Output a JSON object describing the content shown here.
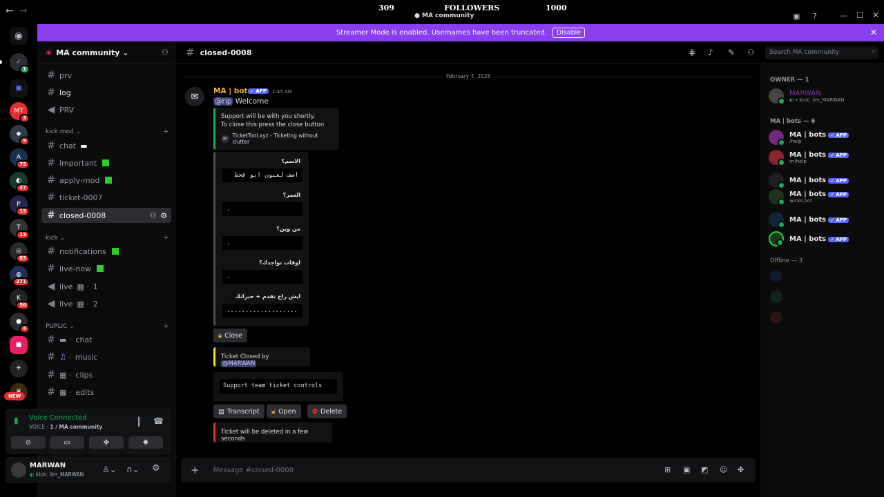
{
  "titlebar": {
    "left_num": "309",
    "center": "FOLLOWERS",
    "right_num": "1000",
    "server": "MA community"
  },
  "banner": {
    "text": "Streamer Mode is enabled. Usernames have been truncated.",
    "disable": "Disable"
  },
  "rail": {
    "badges": [
      "3",
      "9",
      "75",
      "47",
      "19",
      "13",
      "83",
      "271",
      "56",
      "4"
    ],
    "new_label": "NEW"
  },
  "server_name": "MA community",
  "channels": [
    {
      "name": "prv",
      "type": "#"
    },
    {
      "name": "log",
      "type": "#"
    },
    {
      "name": "PRV",
      "type": "speaker"
    }
  ],
  "cat_kickmod": "kick mod",
  "kickmod_channels": [
    "chat",
    "important",
    "apply-mod",
    "ticket-0007",
    "closed-0008"
  ],
  "cat_kick": "kick",
  "kick_channels": [
    "notifications",
    "live-now",
    "live",
    "live"
  ],
  "live_nums": [
    "1",
    "2"
  ],
  "cat_puplic": "PUPLIC",
  "puplic_channels": [
    "chat",
    "music",
    "clips",
    "edits"
  ],
  "voice": {
    "title": "Voice Connected",
    "sub_prefix": "VOICE",
    "sub": "1 / MA community"
  },
  "user": {
    "name": "MARWAN",
    "status": "kick: iim_MARWAN"
  },
  "header": {
    "channel": "closed-0008",
    "search": "Search MA community"
  },
  "date_divider": "February 7, 2026",
  "msg": {
    "author": "MA | bots",
    "tag": "APP",
    "time": "1:45 AM",
    "mention": "@rip",
    "text": "Welcome"
  },
  "embed1": {
    "line1": "Support will be with you shortly.",
    "line2": "To close this press the close button",
    "footer": "TicketTool.xyz - Ticketing without clutter"
  },
  "form": [
    {
      "q": "الاسم؟",
      "a": "اصف لعيون ابو قحط"
    },
    {
      "q": "العمر؟",
      "a": "."
    },
    {
      "q": "من وين؟",
      "a": "."
    },
    {
      "q": "اوقات تواجدك؟",
      "a": "."
    },
    {
      "q": "ايش راح تقدم + خبراتك",
      "a": "..................."
    }
  ],
  "close_btn": "Close",
  "closed_by": {
    "text": "Ticket Closed by",
    "user": "@MARWAN"
  },
  "controls": "Support team ticket controls",
  "ctrl_btns": [
    "Transcript",
    "Open",
    "Delete"
  ],
  "deleted": "Ticket will be deleted in a few seconds",
  "composer": {
    "placeholder": "Message #closed-0008"
  },
  "members": {
    "owner_head": "OWNER — 1",
    "owner_name": "MARWAN",
    "owner_status": "kick: iim_MARWAN",
    "bots_head": "MA | bots — 6",
    "bots": [
      {
        "name": "MA | bots",
        "sub": "/help"
      },
      {
        "name": "MA | bots",
        "sub": "m!help"
      },
      {
        "name": "MA | bots",
        "sub": ""
      },
      {
        "name": "MA | bots",
        "sub": "wicks.bot"
      },
      {
        "name": "MA | bots",
        "sub": ""
      },
      {
        "name": "MA | bots",
        "sub": ""
      }
    ],
    "offline_head": "Offline — 3"
  }
}
